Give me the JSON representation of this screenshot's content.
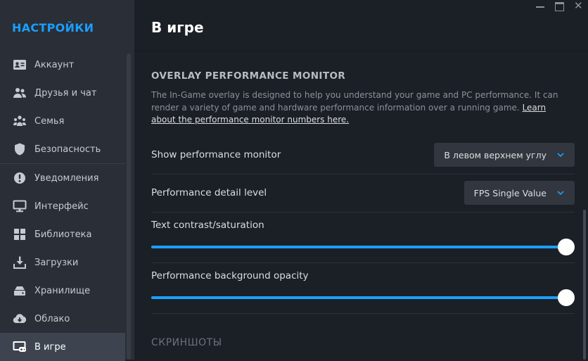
{
  "sidebar": {
    "title": "НАСТРОЙКИ",
    "items": [
      {
        "label": "Аккаунт",
        "icon": "id-card-icon"
      },
      {
        "label": "Друзья и чат",
        "icon": "friends-icon"
      },
      {
        "label": "Семья",
        "icon": "family-icon"
      },
      {
        "label": "Безопасность",
        "icon": "shield-icon"
      },
      {
        "label": "Уведомления",
        "icon": "alert-icon"
      },
      {
        "label": "Интерфейс",
        "icon": "monitor-icon"
      },
      {
        "label": "Библиотека",
        "icon": "grid-icon"
      },
      {
        "label": "Загрузки",
        "icon": "download-icon"
      },
      {
        "label": "Хранилище",
        "icon": "storage-icon"
      },
      {
        "label": "Облако",
        "icon": "cloud-icon"
      },
      {
        "label": "В игре",
        "icon": "in-game-icon"
      }
    ],
    "active_index": 10
  },
  "main": {
    "title": "В игре",
    "overlay_section": {
      "heading": "OVERLAY PERFORMANCE MONITOR",
      "description": "The In-Game overlay is designed to help you understand your game and PC performance. It can render a variety of game and hardware performance information over a running game.",
      "link_text": "Learn about the performance monitor numbers here."
    },
    "settings": {
      "show_monitor": {
        "label": "Show performance monitor",
        "value": "В левом верхнем углу"
      },
      "detail_level": {
        "label": "Performance detail level",
        "value": "FPS Single Value"
      },
      "text_contrast": {
        "label": "Text contrast/saturation",
        "value": 1.0
      },
      "bg_opacity": {
        "label": "Performance background opacity",
        "value": 1.0
      }
    },
    "next_section": "СКРИНШОТЫ"
  },
  "colors": {
    "accent": "#1a9fff",
    "sidebar_bg": "#2a2e36",
    "main_bg": "#1b1f26",
    "active_item_bg": "#3d4450"
  }
}
